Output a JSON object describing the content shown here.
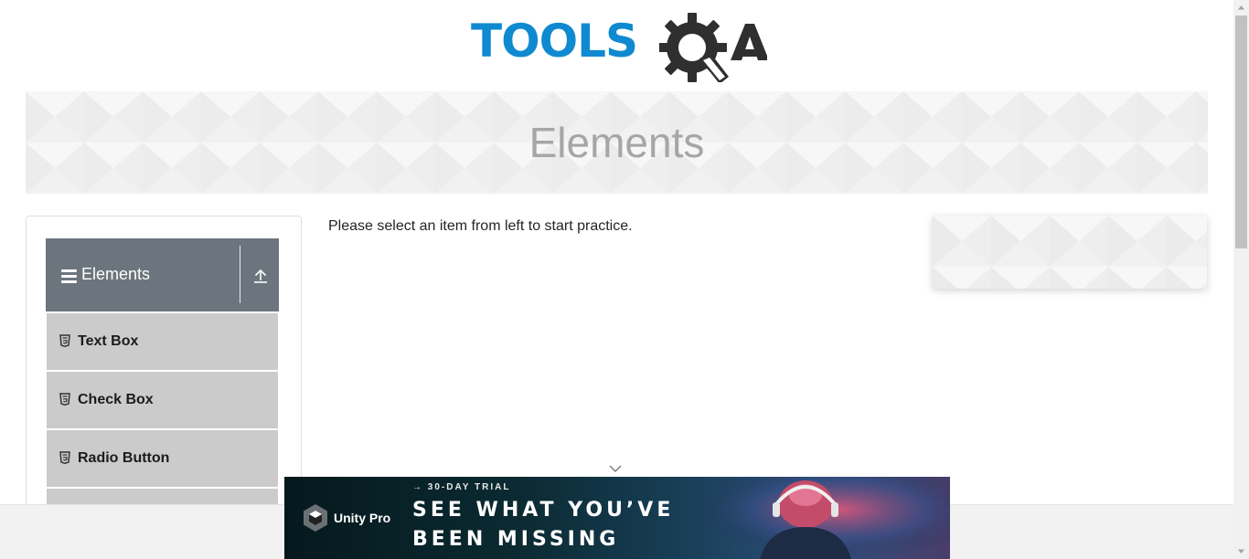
{
  "header": {
    "logo_text": "TOOLS",
    "logo_qa": "QA"
  },
  "banner": {
    "title": "Elements"
  },
  "sidebar": {
    "group_title": "Elements",
    "items": [
      {
        "label": "Text Box",
        "icon": "html5-icon"
      },
      {
        "label": "Check Box",
        "icon": "html5-icon"
      },
      {
        "label": "Radio Button",
        "icon": "html5-icon"
      }
    ]
  },
  "main": {
    "instruction": "Please select an item from left to start practice."
  },
  "ad": {
    "brand": "Unity Pro",
    "kicker": "→ 30-DAY TRIAL",
    "headline_line1": "SEE WHAT YOU’VE",
    "headline_line2": "BEEN MISSING"
  },
  "colors": {
    "brand_blue": "#0f8ad0",
    "group_header": "#6c757d",
    "menu_item_bg": "#cbcbcb"
  }
}
